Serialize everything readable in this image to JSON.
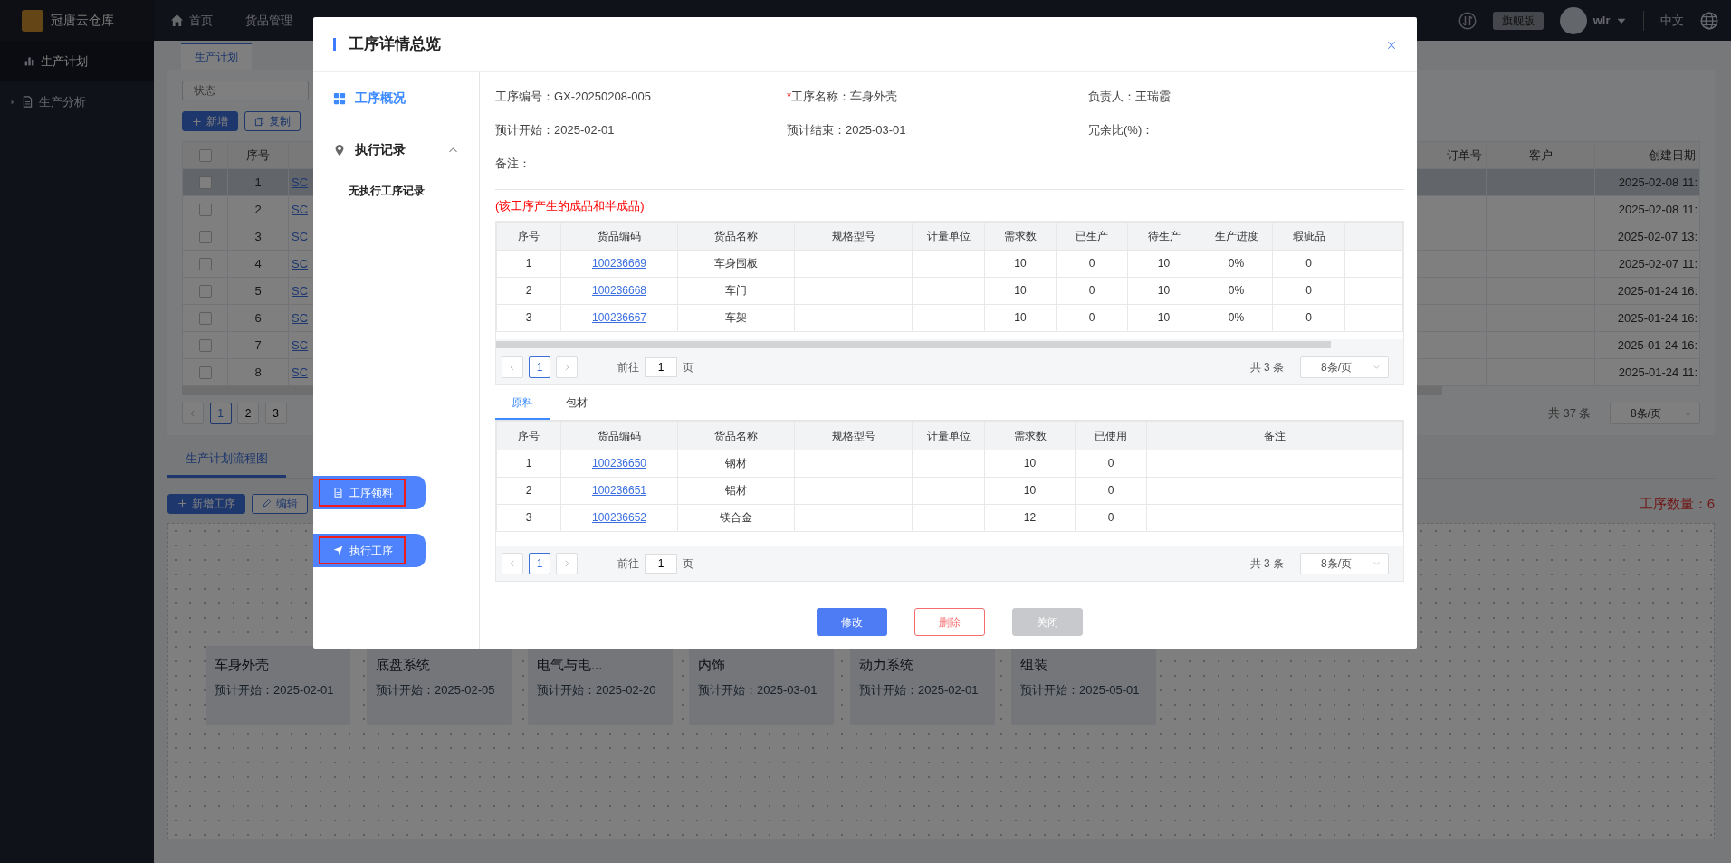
{
  "app": {
    "logo_text": "冠唐云仓库",
    "nav": [
      {
        "label": "首页",
        "selected": false
      },
      {
        "label": "货品管理",
        "selected": false
      }
    ],
    "edition_badge": "旗舰版",
    "user": "wlr",
    "language": "中文"
  },
  "sidebar": {
    "items": [
      {
        "label": "生产计划",
        "kind": "link",
        "selected": true
      },
      {
        "label": "生产分析",
        "kind": "group",
        "selected": false,
        "expanded": false
      }
    ]
  },
  "page_tabs": [
    {
      "label": "生产计划",
      "selected": true
    }
  ],
  "filter": {
    "placeholder": "状态"
  },
  "toolbar": [
    {
      "label": "新增",
      "kind": "primary"
    },
    {
      "label": "复制",
      "kind": "outline"
    }
  ],
  "plan_table": {
    "all_checked": false,
    "columns": [
      "序号",
      "订单号",
      "客户",
      "创建日期"
    ],
    "rows": [
      {
        "index": "1",
        "code": "SC",
        "date": "2025-02-08 11:",
        "selected": true,
        "checked": false
      },
      {
        "index": "2",
        "code": "SC",
        "date": "2025-02-08 11:",
        "selected": false,
        "checked": false
      },
      {
        "index": "3",
        "code": "SC",
        "date": "2025-02-07 13:",
        "selected": false,
        "checked": false
      },
      {
        "index": "4",
        "code": "SC",
        "date": "2025-02-07 11:",
        "selected": false,
        "checked": false
      },
      {
        "index": "5",
        "code": "SC",
        "date": "2025-01-24 16:",
        "selected": false,
        "checked": false
      },
      {
        "index": "6",
        "code": "SC",
        "date": "2025-01-24 16:",
        "selected": false,
        "checked": false
      },
      {
        "index": "7",
        "code": "SC",
        "date": "2025-01-24 16:",
        "selected": false,
        "checked": false
      },
      {
        "index": "8",
        "code": "SC",
        "date": "2025-01-24 11:",
        "selected": false,
        "checked": false
      }
    ]
  },
  "plan_pagination": {
    "pages": [
      {
        "label": "1",
        "selected": true
      },
      {
        "label": "2",
        "selected": false
      },
      {
        "label": "3",
        "selected": false
      }
    ],
    "total": "共 37 条",
    "page_size": "8条/页"
  },
  "flow_tabs": [
    {
      "label": "生产计划流程图",
      "selected": true
    }
  ],
  "flow_toolbar": [
    {
      "label": "新增工序",
      "kind": "primary"
    },
    {
      "label": "编辑",
      "kind": "outline"
    }
  ],
  "process_count": "工序数量：6",
  "process_cards": [
    {
      "name": "车身外壳",
      "start": "预计开始：2025-02-01"
    },
    {
      "name": "底盘系统",
      "start": "预计开始：2025-02-05"
    },
    {
      "name": "电气与电...",
      "start": "预计开始：2025-02-20"
    },
    {
      "name": "内饰",
      "start": "预计开始：2025-03-01"
    },
    {
      "name": "动力系统",
      "start": "预计开始：2025-02-01"
    },
    {
      "name": "组装",
      "start": "预计开始：2025-05-01"
    }
  ],
  "modal": {
    "title": "工序详情总览",
    "nav": [
      {
        "label": "工序概况",
        "selected": true
      },
      {
        "label": "执行记录",
        "selected": false,
        "expanded": true,
        "empty_text": "无执行工序记录"
      }
    ],
    "actions": [
      {
        "label": "工序领料",
        "highlighted": true
      },
      {
        "label": "执行工序",
        "highlighted": true
      }
    ],
    "info": [
      {
        "label": "工序编号：",
        "value": "GX-20250208-005"
      },
      {
        "marker": "*",
        "label": "工序名称：",
        "value": "车身外壳"
      },
      {
        "label": "负责人：",
        "value": "王瑞霞"
      },
      {
        "label": "预计开始：",
        "value": "2025-02-01"
      },
      {
        "label": "预计结束：",
        "value": "2025-03-01"
      },
      {
        "label": "冗余比(%)："
      },
      {
        "label": "备注："
      }
    ],
    "note": "(该工序产生的成品和半成品)",
    "products_table": {
      "columns": [
        "序号",
        "货品编码",
        "货品名称",
        "规格型号",
        "计量单位",
        "需求数",
        "已生产",
        "待生产",
        "生产进度",
        "瑕疵品"
      ],
      "rows": [
        {
          "index": "1",
          "code": "100236669",
          "name": "车身围板",
          "demand": "10",
          "produced": "0",
          "pending": "10",
          "progress": "0%",
          "defects": "0"
        },
        {
          "index": "2",
          "code": "100236668",
          "name": "车门",
          "demand": "10",
          "produced": "0",
          "pending": "10",
          "progress": "0%",
          "defects": "0"
        },
        {
          "index": "3",
          "code": "100236667",
          "name": "车架",
          "demand": "10",
          "produced": "0",
          "pending": "10",
          "progress": "0%",
          "defects": "0"
        }
      ]
    },
    "products_pagination": {
      "page": "1",
      "goto_label": "前往",
      "goto_value": "1",
      "page_suffix": "页",
      "total": "共 3 条",
      "page_size": "8条/页"
    },
    "material_tabs": [
      {
        "label": "原料",
        "selected": true
      },
      {
        "label": "包材",
        "selected": false
      }
    ],
    "materials_table": {
      "columns": [
        "序号",
        "货品编码",
        "货品名称",
        "规格型号",
        "计量单位",
        "需求数",
        "已使用",
        "备注"
      ],
      "rows": [
        {
          "index": "1",
          "code": "100236650",
          "name": "钢材",
          "demand": "10",
          "used": "0"
        },
        {
          "index": "2",
          "code": "100236651",
          "name": "铝材",
          "demand": "10",
          "used": "0"
        },
        {
          "index": "3",
          "code": "100236652",
          "name": "镁合金",
          "demand": "12",
          "used": "0"
        }
      ]
    },
    "materials_pagination": {
      "page": "1",
      "goto_label": "前往",
      "goto_value": "1",
      "page_suffix": "页",
      "total": "共 3 条",
      "page_size": "8条/页"
    },
    "footer_buttons": [
      {
        "label": "修改",
        "kind": "primary",
        "disabled": false
      },
      {
        "label": "删除",
        "kind": "danger",
        "disabled": false
      },
      {
        "label": "关闭",
        "kind": "secondary",
        "disabled": true
      }
    ]
  }
}
